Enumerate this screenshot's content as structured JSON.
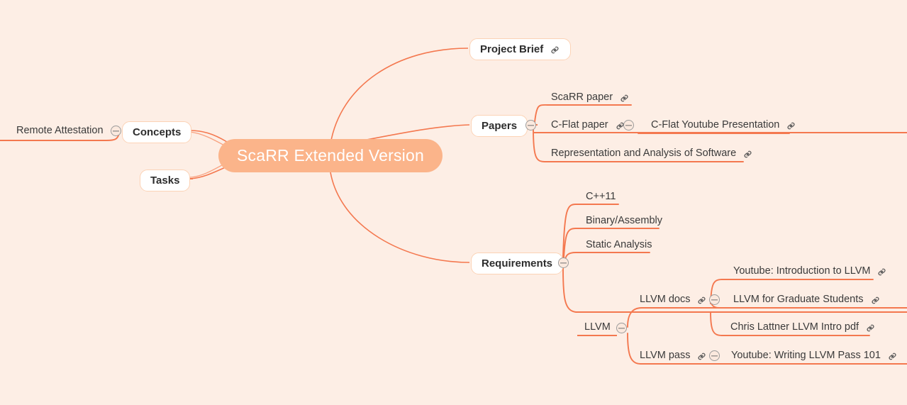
{
  "theme": {
    "background": "#fdeee5",
    "branch_color": "#f4784f",
    "branch_color_light": "#f8a07e",
    "root_fill": "#fbb48a",
    "root_text": "#ffffff",
    "box_fill": "#ffffff",
    "box_border": "#fcd3b6",
    "text_color": "#2d2d2d",
    "toggle_stroke": "#9b9b9b"
  },
  "icons": {
    "link": "link-icon",
    "collapse": "collapse-minus-icon"
  },
  "root": {
    "label": "ScaRR Extended Version"
  },
  "nodes": {
    "remote_attestation": "Remote Attestation",
    "concepts": "Concepts",
    "tasks": "Tasks",
    "project_brief": "Project Brief",
    "papers": "Papers",
    "scarr_paper": "ScaRR paper",
    "cflat_paper": "C-Flat paper",
    "cflat_youtube": "C-Flat Youtube Presentation",
    "representation": "Representation and Analysis of Software",
    "requirements": "Requirements",
    "cpp11": "C++11",
    "binary_assembly": "Binary/Assembly",
    "static_analysis": "Static Analysis",
    "llvm": "LLVM",
    "llvm_docs": "LLVM docs",
    "llvm_pass": "LLVM pass",
    "youtube_intro_llvm": "Youtube: Introduction to LLVM",
    "llvm_graduate": "LLVM for Graduate Students",
    "chris_lattner": "Chris Lattner LLVM Intro pdf",
    "youtube_writing_pass": "Youtube: Writing LLVM Pass 101"
  }
}
